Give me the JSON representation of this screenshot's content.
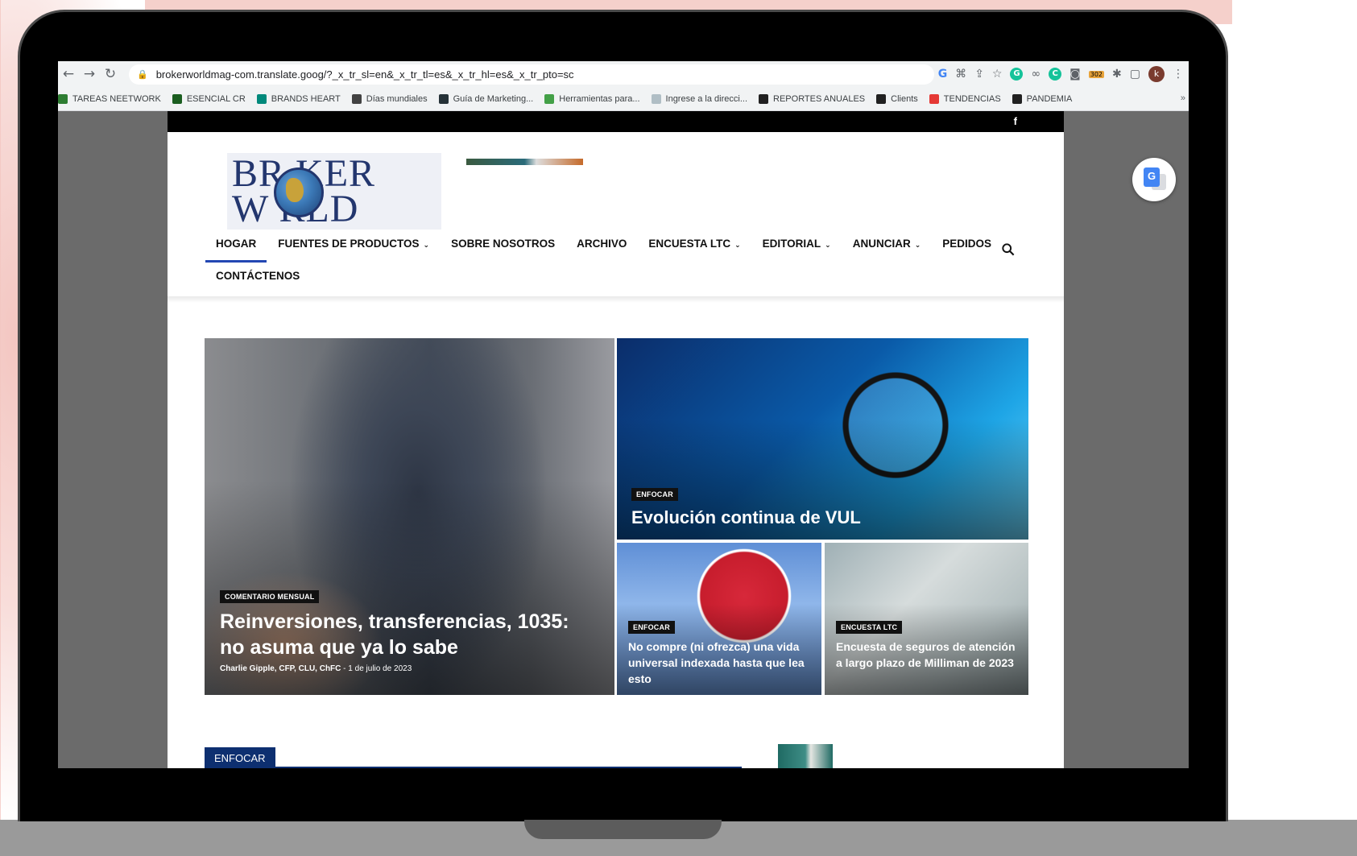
{
  "browser": {
    "url": "brokerworldmag-com.translate.goog/?_x_tr_sl=en&_x_tr_tl=es&_x_tr_hl=es&_x_tr_pto=sc",
    "ext_badge": "302",
    "avatar_letter": "k"
  },
  "bookmarks": [
    {
      "label": "TAREAS NEETWORK",
      "color": "#2e7d32"
    },
    {
      "label": "ESENCIAL CR",
      "color": "#1b5e20"
    },
    {
      "label": "BRANDS HEART",
      "color": "#00897b"
    },
    {
      "label": "Días mundiales",
      "color": "#424242"
    },
    {
      "label": "Guía de Marketing...",
      "color": "#263238"
    },
    {
      "label": "Herramientas para...",
      "color": "#43a047"
    },
    {
      "label": "Ingrese a la direcci...",
      "color": "#b0bec5"
    },
    {
      "label": "REPORTES ANUALES",
      "color": "#212121"
    },
    {
      "label": "Clients",
      "color": "#212121"
    },
    {
      "label": "TENDENCIAS",
      "color": "#e53935"
    },
    {
      "label": "PANDEMIA",
      "color": "#212121"
    }
  ],
  "bookmarks_more": "»",
  "site": {
    "social_fb": "f",
    "logo_line1": "BR KER",
    "logo_line2": "W RLD",
    "nav": [
      {
        "label": "HOGAR",
        "caret": ""
      },
      {
        "label": "FUENTES DE PRODUCTOS",
        "caret": "⌄"
      },
      {
        "label": "SOBRE NOSOTROS",
        "caret": ""
      },
      {
        "label": "ARCHIVO",
        "caret": ""
      },
      {
        "label": "ENCUESTA LTC",
        "caret": "⌄"
      },
      {
        "label": "EDITORIAL",
        "caret": "⌄"
      },
      {
        "label": "ANUNCIAR",
        "caret": "⌄"
      },
      {
        "label": "PEDIDOS",
        "caret": ""
      }
    ],
    "nav_second_row": "CONTÁCTENOS"
  },
  "articles": {
    "main": {
      "category": "COMENTARIO MENSUAL",
      "title": "Reinversiones, transferencias, 1035: no asuma que ya lo sabe",
      "author": "Charlie Gipple, CFP, CLU, ChFC",
      "separator": "-",
      "date": "1 de julio de 2023"
    },
    "top_right": {
      "category": "ENFOCAR",
      "title": "Evolución continua de VUL"
    },
    "bottom_left": {
      "category": "ENFOCAR",
      "title": "No compre (ni ofrezca) una vida universal indexada hasta que lea esto"
    },
    "bottom_right": {
      "category": "ENCUESTA LTC",
      "title": "Encuesta de seguros de atención a largo plazo de Milliman de 2023"
    }
  },
  "section": {
    "label": "ENFOCAR"
  },
  "colors": {
    "nav_active": "#2347b3",
    "section_blue": "#0d2f70"
  }
}
